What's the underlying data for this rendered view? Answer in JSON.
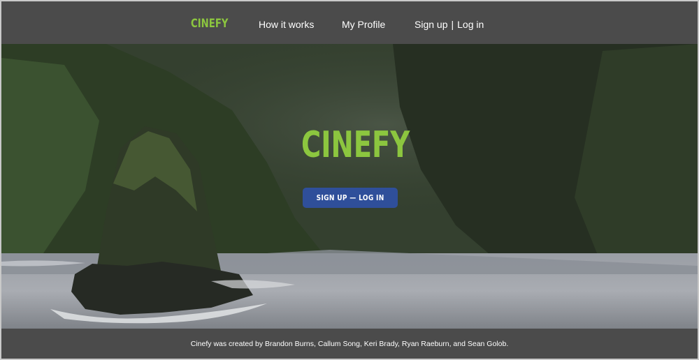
{
  "colors": {
    "brand": "#8cc63f",
    "nav_background": "#4b4b4b",
    "button_background": "#2f4f9a",
    "text": "#ffffff"
  },
  "nav": {
    "brand": "CINEFY",
    "links": {
      "how_it_works": "How it works",
      "my_profile": "My Profile",
      "sign_up": "Sign up",
      "separator": "|",
      "log_in": "Log in"
    }
  },
  "hero": {
    "title": "CINEFY",
    "button_label": "SIGN UP — LOG IN",
    "background_image": "coastal cliffs with sea stack"
  },
  "footer": {
    "credits": "Cinefy was created by Brandon Burns, Callum Song, Keri Brady, Ryan Raeburn, and Sean Golob."
  }
}
